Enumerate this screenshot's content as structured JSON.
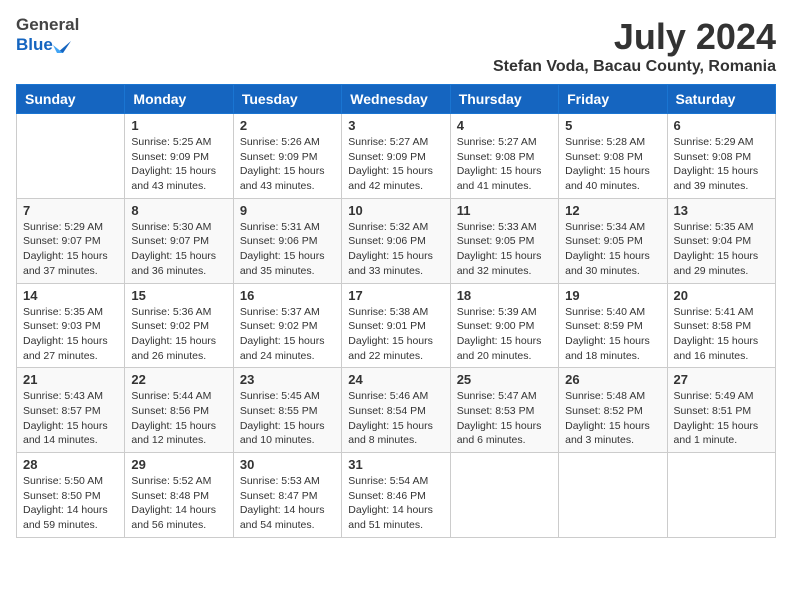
{
  "header": {
    "logo_general": "General",
    "logo_blue": "Blue",
    "month_title": "July 2024",
    "location": "Stefan Voda, Bacau County, Romania"
  },
  "days_of_week": [
    "Sunday",
    "Monday",
    "Tuesday",
    "Wednesday",
    "Thursday",
    "Friday",
    "Saturday"
  ],
  "weeks": [
    [
      {
        "day": "",
        "info": ""
      },
      {
        "day": "1",
        "info": "Sunrise: 5:25 AM\nSunset: 9:09 PM\nDaylight: 15 hours\nand 43 minutes."
      },
      {
        "day": "2",
        "info": "Sunrise: 5:26 AM\nSunset: 9:09 PM\nDaylight: 15 hours\nand 43 minutes."
      },
      {
        "day": "3",
        "info": "Sunrise: 5:27 AM\nSunset: 9:09 PM\nDaylight: 15 hours\nand 42 minutes."
      },
      {
        "day": "4",
        "info": "Sunrise: 5:27 AM\nSunset: 9:08 PM\nDaylight: 15 hours\nand 41 minutes."
      },
      {
        "day": "5",
        "info": "Sunrise: 5:28 AM\nSunset: 9:08 PM\nDaylight: 15 hours\nand 40 minutes."
      },
      {
        "day": "6",
        "info": "Sunrise: 5:29 AM\nSunset: 9:08 PM\nDaylight: 15 hours\nand 39 minutes."
      }
    ],
    [
      {
        "day": "7",
        "info": "Sunrise: 5:29 AM\nSunset: 9:07 PM\nDaylight: 15 hours\nand 37 minutes."
      },
      {
        "day": "8",
        "info": "Sunrise: 5:30 AM\nSunset: 9:07 PM\nDaylight: 15 hours\nand 36 minutes."
      },
      {
        "day": "9",
        "info": "Sunrise: 5:31 AM\nSunset: 9:06 PM\nDaylight: 15 hours\nand 35 minutes."
      },
      {
        "day": "10",
        "info": "Sunrise: 5:32 AM\nSunset: 9:06 PM\nDaylight: 15 hours\nand 33 minutes."
      },
      {
        "day": "11",
        "info": "Sunrise: 5:33 AM\nSunset: 9:05 PM\nDaylight: 15 hours\nand 32 minutes."
      },
      {
        "day": "12",
        "info": "Sunrise: 5:34 AM\nSunset: 9:05 PM\nDaylight: 15 hours\nand 30 minutes."
      },
      {
        "day": "13",
        "info": "Sunrise: 5:35 AM\nSunset: 9:04 PM\nDaylight: 15 hours\nand 29 minutes."
      }
    ],
    [
      {
        "day": "14",
        "info": "Sunrise: 5:35 AM\nSunset: 9:03 PM\nDaylight: 15 hours\nand 27 minutes."
      },
      {
        "day": "15",
        "info": "Sunrise: 5:36 AM\nSunset: 9:02 PM\nDaylight: 15 hours\nand 26 minutes."
      },
      {
        "day": "16",
        "info": "Sunrise: 5:37 AM\nSunset: 9:02 PM\nDaylight: 15 hours\nand 24 minutes."
      },
      {
        "day": "17",
        "info": "Sunrise: 5:38 AM\nSunset: 9:01 PM\nDaylight: 15 hours\nand 22 minutes."
      },
      {
        "day": "18",
        "info": "Sunrise: 5:39 AM\nSunset: 9:00 PM\nDaylight: 15 hours\nand 20 minutes."
      },
      {
        "day": "19",
        "info": "Sunrise: 5:40 AM\nSunset: 8:59 PM\nDaylight: 15 hours\nand 18 minutes."
      },
      {
        "day": "20",
        "info": "Sunrise: 5:41 AM\nSunset: 8:58 PM\nDaylight: 15 hours\nand 16 minutes."
      }
    ],
    [
      {
        "day": "21",
        "info": "Sunrise: 5:43 AM\nSunset: 8:57 PM\nDaylight: 15 hours\nand 14 minutes."
      },
      {
        "day": "22",
        "info": "Sunrise: 5:44 AM\nSunset: 8:56 PM\nDaylight: 15 hours\nand 12 minutes."
      },
      {
        "day": "23",
        "info": "Sunrise: 5:45 AM\nSunset: 8:55 PM\nDaylight: 15 hours\nand 10 minutes."
      },
      {
        "day": "24",
        "info": "Sunrise: 5:46 AM\nSunset: 8:54 PM\nDaylight: 15 hours\nand 8 minutes."
      },
      {
        "day": "25",
        "info": "Sunrise: 5:47 AM\nSunset: 8:53 PM\nDaylight: 15 hours\nand 6 minutes."
      },
      {
        "day": "26",
        "info": "Sunrise: 5:48 AM\nSunset: 8:52 PM\nDaylight: 15 hours\nand 3 minutes."
      },
      {
        "day": "27",
        "info": "Sunrise: 5:49 AM\nSunset: 8:51 PM\nDaylight: 15 hours\nand 1 minute."
      }
    ],
    [
      {
        "day": "28",
        "info": "Sunrise: 5:50 AM\nSunset: 8:50 PM\nDaylight: 14 hours\nand 59 minutes."
      },
      {
        "day": "29",
        "info": "Sunrise: 5:52 AM\nSunset: 8:48 PM\nDaylight: 14 hours\nand 56 minutes."
      },
      {
        "day": "30",
        "info": "Sunrise: 5:53 AM\nSunset: 8:47 PM\nDaylight: 14 hours\nand 54 minutes."
      },
      {
        "day": "31",
        "info": "Sunrise: 5:54 AM\nSunset: 8:46 PM\nDaylight: 14 hours\nand 51 minutes."
      },
      {
        "day": "",
        "info": ""
      },
      {
        "day": "",
        "info": ""
      },
      {
        "day": "",
        "info": ""
      }
    ]
  ]
}
